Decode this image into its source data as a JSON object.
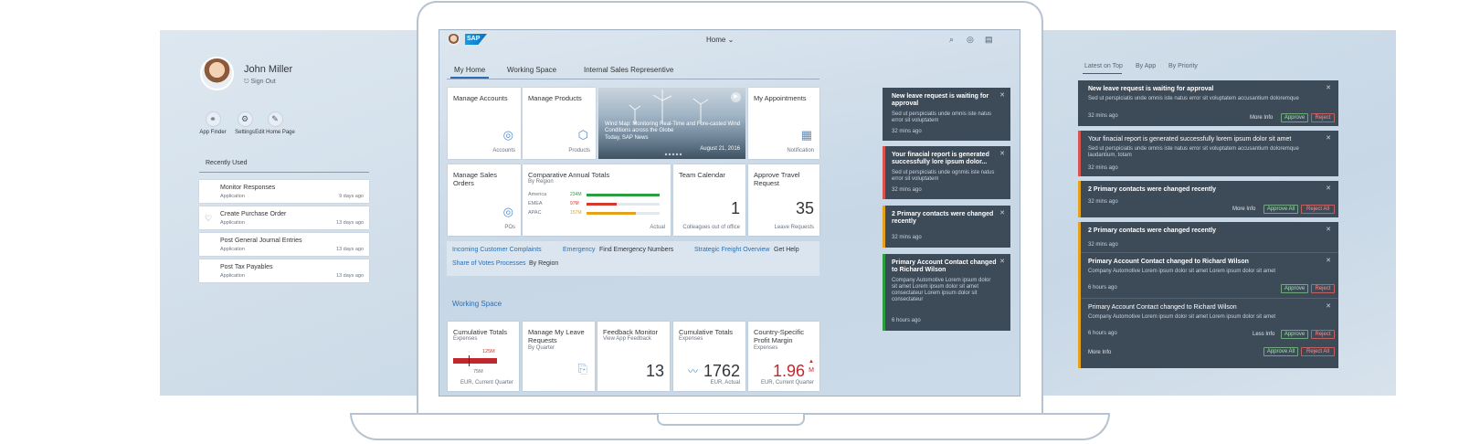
{
  "left_panel": {
    "user_name": "John Miller",
    "sign_out": "Sign Out",
    "actions": [
      {
        "label": "App Finder",
        "icon": "binoculars-icon"
      },
      {
        "label": "Settings",
        "icon": "gear-icon"
      },
      {
        "label": "Edit Home Page",
        "icon": "pencil-icon"
      }
    ],
    "recently_used_title": "Recently Used",
    "recently_used": [
      {
        "title": "Monitor Responses",
        "type": "Application",
        "when": "9 days ago"
      },
      {
        "title": "Create Purchase Order",
        "type": "Application",
        "when": "13 days ago"
      },
      {
        "title": "Post General Journal Entries",
        "type": "Application",
        "when": "13 days ago"
      },
      {
        "title": "Post Tax Payables",
        "type": "Application",
        "when": "13 days ago"
      }
    ]
  },
  "header": {
    "logo": "SAP",
    "title": "Home"
  },
  "tabs": [
    "My Home",
    "Working Space",
    "Internal Sales Representive"
  ],
  "tiles": {
    "manage_accounts": {
      "title": "Manage Accounts",
      "footer": "Accounts"
    },
    "manage_products": {
      "title": "Manage Products",
      "footer": "Products"
    },
    "news": {
      "title": "Wind Map: Monitoring Real-Time and Fore-casted Wind Conditions across the Globe",
      "source": "Today, SAP News",
      "date": "August 21, 2016"
    },
    "my_appointments": {
      "title": "My Appointments",
      "footer": "Notification"
    },
    "manage_sales_orders": {
      "title": "Manage Sales Orders",
      "footer": "POs"
    },
    "comparative": {
      "title": "Comparative Annual Totals",
      "subtitle": "By Region",
      "footer": "Actual",
      "rows": [
        {
          "label": "America",
          "value": "234M",
          "fill": 1.0,
          "color": "#2b9e3f"
        },
        {
          "label": "EMEA",
          "value": "97M",
          "fill": 0.41,
          "color": "#d33a2c"
        },
        {
          "label": "APAC",
          "value": "157M",
          "fill": 0.67,
          "color": "#e5a11a"
        }
      ]
    },
    "team_calendar": {
      "title": "Team Calendar",
      "number": "1",
      "footer": "Colleagues out of office"
    },
    "approve_travel": {
      "title": "Approve Travel Request",
      "number": "35",
      "footer": "Leave Requests"
    }
  },
  "links": [
    {
      "link": "Incoming Customer Complaints",
      "sub": ""
    },
    {
      "link": "Emergency",
      "sub": "Find Emergency Numbers"
    },
    {
      "link": "Strategic Freight Overview",
      "sub": "Get Help"
    },
    {
      "link": "Share of Votes Processes",
      "sub": "By Region"
    }
  ],
  "working_space": {
    "title": "Working Space",
    "tiles": [
      {
        "title": "Cumulative Totals",
        "subtitle": "Expenses",
        "footer": "EUR, Current Quarter",
        "label_top": "125M",
        "label_bottom": "75M"
      },
      {
        "title": "Manage My Leave Requests",
        "subtitle": "By Quarter",
        "footer": ""
      },
      {
        "title": "Feedback Monitor",
        "subtitle": "View App Feedback",
        "number": "13"
      },
      {
        "title": "Cumulative Totals",
        "subtitle": "Expenses",
        "number": "1762",
        "footer": "EUR, Actual"
      },
      {
        "title": "Country-Specific Profit Margin",
        "subtitle": "Expenses",
        "number": "1.96",
        "unit": "M",
        "footer": "EUR, Current Quarter"
      }
    ]
  },
  "screen_notifications": [
    {
      "title": "New leave request is waiting for approval",
      "body": "Sed ut perspiciatis unde omnis iste natus error sit voluptatem",
      "time": "32 mins ago",
      "accent": "#3d4a57"
    },
    {
      "title": "Your finacial report is generated successfully lore ipsum dolor...",
      "body": "Sed ut perspiciatis unde ognmis iste natus error sit voluptatem",
      "time": "32 mins ago",
      "accent": "#d9534f"
    },
    {
      "title": "2 Primary contacts were changed recently",
      "body": "",
      "time": "32 mins ago",
      "accent": "#e5a11a"
    },
    {
      "title": "Primary Account Contact changed to Richard Wilson",
      "body": "Company Automotive Lorem ipsum dolor sit amet Lorem ipsum dolor sit amet consectateur Lorem ipsum dolor sit consectateur",
      "time": "6 hours ago",
      "accent": "#2b9e3f"
    }
  ],
  "right_panel": {
    "tabs": [
      "Latest on Top",
      "By App",
      "By Priority"
    ],
    "notifications": [
      {
        "title": "New leave request is waiting for approval",
        "body": "Sed ut perspiciatis unde omnis iste natus error sit voluptatem accusantium doloremque",
        "time": "32 mins ago",
        "more": "More Info",
        "approve": "Approve",
        "reject": "Reject"
      },
      {
        "title": "Your finacial report is generated successfully lorem ipsum dolor sit amet",
        "body": "Sed ut perspiciatis unde omnis iste natus error sit voluptatem accusantium doloremque laudantium, totam",
        "time": "32 mins ago"
      },
      {
        "title": "2 Primary contacts were changed recently",
        "time": "32 mins ago",
        "more": "More Info",
        "approve": "Approve All",
        "reject": "Reject All"
      },
      {
        "title": "2 Primary contacts were changed recently",
        "time": "32 mins ago"
      }
    ],
    "sub_items": [
      {
        "title": "Primary Account Contact changed to Richard Wilson",
        "body": "Company Automotive Lorem ipsum dolor sit amet Lorem ipsum dolor sit amet",
        "time": "6 hours ago",
        "approve": "Approve",
        "reject": "Reject"
      },
      {
        "title": "Primary Account Contact changed to Richard Wilson",
        "body": "Company Automotive Lorem ipsum dolor sit amet Lorem ipsum dolor sit amet",
        "time": "6 hours ago",
        "less": "Less Info",
        "approve": "Approve",
        "reject": "Reject"
      }
    ],
    "footer_more": "More Info",
    "footer_approve": "Approve All",
    "footer_reject": "Reject All"
  }
}
